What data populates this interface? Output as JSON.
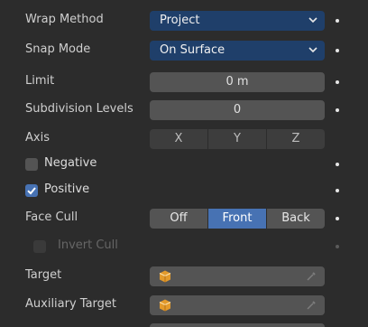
{
  "wrap_method": {
    "label": "Wrap Method",
    "value": "Project"
  },
  "snap_mode": {
    "label": "Snap Mode",
    "value": "On Surface"
  },
  "limit": {
    "label": "Limit",
    "value": "0 m"
  },
  "subdivision": {
    "label": "Subdivision Levels",
    "value": "0"
  },
  "axis": {
    "label": "Axis",
    "options": [
      "X",
      "Y",
      "Z"
    ]
  },
  "negative": {
    "label": "Negative",
    "checked": false
  },
  "positive": {
    "label": "Positive",
    "checked": true
  },
  "face_cull": {
    "label": "Face Cull",
    "options": [
      "Off",
      "Front",
      "Back"
    ],
    "selected": "Front"
  },
  "invert_cull": {
    "label": "Invert Cull",
    "checked": false,
    "enabled": false
  },
  "target": {
    "label": "Target",
    "value": ""
  },
  "aux_target": {
    "label": "Auxiliary Target",
    "value": ""
  },
  "colors": {
    "accent": "#4772b3",
    "select_bg": "#1f3f6a",
    "field_bg": "#545454",
    "panel_bg": "#2c2c2c",
    "object_icon": "#e39a2b"
  }
}
